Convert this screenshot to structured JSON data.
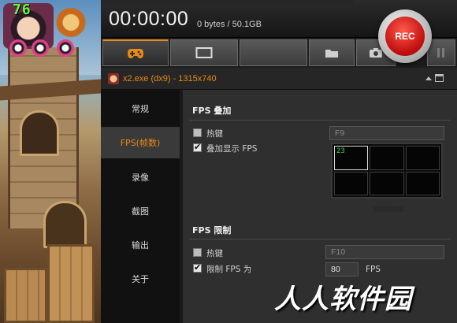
{
  "app": {
    "timer": "00:00:00",
    "storage": "0 bytes / 50.1GB",
    "rec_label": "REC",
    "accent": "#e98a16"
  },
  "game_overlay": {
    "fps_value": "76"
  },
  "tabs": [
    {
      "icon": "gamepad-icon",
      "active": true
    },
    {
      "icon": "screen-icon",
      "active": false
    },
    {
      "icon": "blank",
      "active": false
    },
    {
      "icon": "folder-icon",
      "active": false
    },
    {
      "icon": "camera-icon",
      "active": false
    },
    {
      "icon": "pause-icon",
      "active": false
    }
  ],
  "window_info": {
    "title": "x2.exe (dx9) - 1315x740"
  },
  "sidebar": {
    "items": [
      {
        "label": "常规",
        "active": false
      },
      {
        "label": "FPS(帧数)",
        "active": true
      },
      {
        "label": "录像",
        "active": false
      },
      {
        "label": "截图",
        "active": false
      },
      {
        "label": "输出",
        "active": false
      },
      {
        "label": "关于",
        "active": false
      }
    ]
  },
  "fps_overlay_section": {
    "title": "FPS 叠加",
    "hotkey_label": "热键",
    "hotkey_checked": false,
    "hotkey_value": "F9",
    "show_label": "叠加显示 FPS",
    "show_checked": true,
    "preview_fps": "23"
  },
  "fps_limit_section": {
    "title": "FPS 限制",
    "hotkey_label": "热键",
    "hotkey_checked": false,
    "hotkey_value": "F10",
    "limit_label": "限制 FPS 为",
    "limit_checked": true,
    "limit_value": "80",
    "limit_unit": "FPS"
  },
  "watermark": "人人软件园"
}
